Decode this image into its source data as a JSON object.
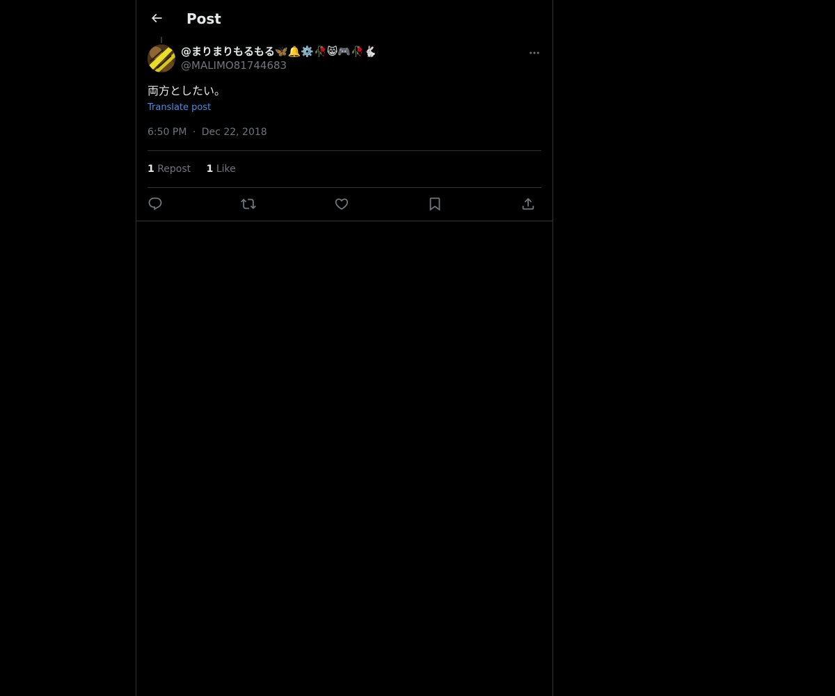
{
  "header": {
    "title": "Post"
  },
  "post": {
    "display_name": "@まりまりもるもる🦋🔔⚙️🥀😸🎮🥀🐇",
    "handle": "@MALIMO81744683",
    "text": "両方としたい。",
    "translate_label": "Translate post",
    "time": "6:50 PM",
    "separator": "·",
    "date": "Dec 22, 2018"
  },
  "stats": {
    "reposts_count": "1",
    "reposts_label": "Repost",
    "likes_count": "1",
    "likes_label": "Like"
  },
  "icons": {
    "back": "arrow-left-icon",
    "more": "more-horizontal-icon",
    "reply": "reply-icon",
    "repost": "repost-icon",
    "like": "heart-icon",
    "bookmark": "bookmark-icon",
    "share": "share-icon"
  },
  "colors": {
    "background": "#000000",
    "text_primary": "#e7e9ea",
    "text_secondary": "#71767b",
    "link": "#4a90e2",
    "border": "#2f3336"
  }
}
